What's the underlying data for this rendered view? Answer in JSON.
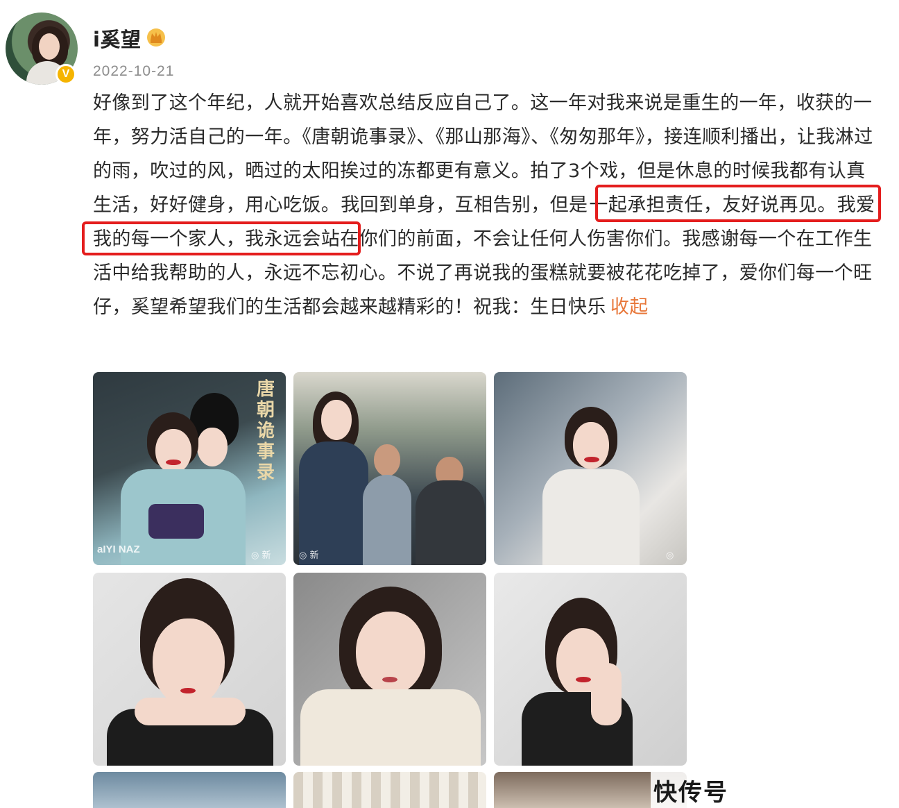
{
  "post": {
    "username": "i奚望",
    "date": "2022-10-21",
    "text_before_box1": "好像到了这个年纪，人就开始喜欢总结反应自己了。这一年对我来说是重生的一年，收获的一年，努力活自己的一年。《唐朝诡事录》、《那山那海》、《匆匆那年》，接连顺利播出，让我淋过的雨，吹过的风，晒过的太阳挨过的冻都更有意义。拍了3个戏，但是休息的时候我都有认真生活，好好健身，用心吃饭。",
    "highlight_1": "我回到单身，互相告别，但是",
    "highlight_2": "一起承担责任，友好说再见。",
    "text_after_box2": "我爱我的每一个家人，我永远会站在你们的前面，不会让任何人伤害你们。我感谢每一个在工作生活中给我帮助的人，永远不忘初心。不说了再说我的蛋糕就要被花花吃掉了，爱你们每一个旺仔，奚望希望我们的生活都会越来越精彩的！祝我：生日快乐",
    "collapse_label": "收起",
    "verified_badge": "V"
  },
  "images": {
    "poster_title": "唐朝诡事录",
    "iqiyi_mark": "aIYI NAZ",
    "weibo_mark": "◎ 新"
  },
  "watermark": "快传号",
  "colors": {
    "link": "#e8783b",
    "highlight_box": "#e41d1d",
    "verified": "#f5b400"
  }
}
